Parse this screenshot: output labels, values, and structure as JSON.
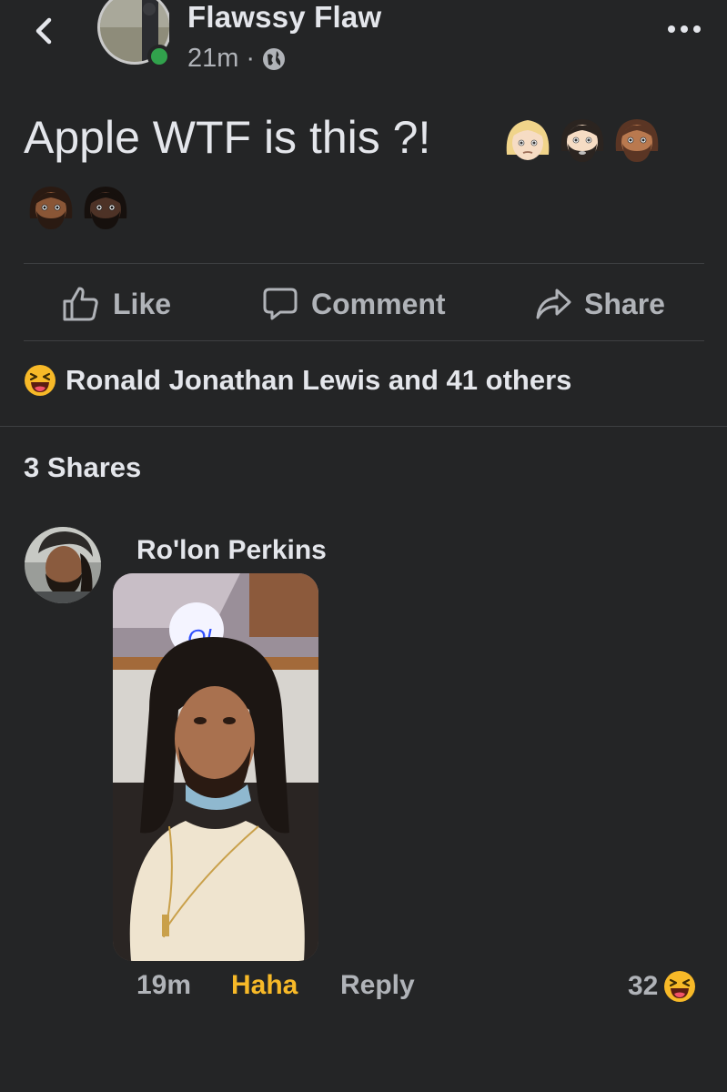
{
  "post": {
    "author": "Flawssy Flaw",
    "time": "21m",
    "separator": "·",
    "text": "Apple WTF is this ?!",
    "emojis_row1": [
      "woman-light-blonde-emoji",
      "man-beard-light-emoji",
      "man-beard-medium-emoji"
    ],
    "emojis_row2": [
      "man-beard-medium-dark-emoji",
      "man-beard-dark-emoji"
    ]
  },
  "actions": {
    "like": "Like",
    "comment": "Comment",
    "share": "Share"
  },
  "reactions": {
    "summary": "Ronald Jonathan Lewis and 41 others",
    "icon": "haha-emoji"
  },
  "shares": {
    "label": "3 Shares"
  },
  "comment": {
    "author": "Ro'lon Perkins",
    "time": "19m",
    "haha": "Haha",
    "reply": "Reply",
    "reaction_count": "32",
    "photo_sign_text": "Ol"
  },
  "colors": {
    "background": "#242526",
    "text": "#e4e6eb",
    "secondary": "#b0b3b8",
    "haha": "#f7b928",
    "online": "#31a24c"
  }
}
